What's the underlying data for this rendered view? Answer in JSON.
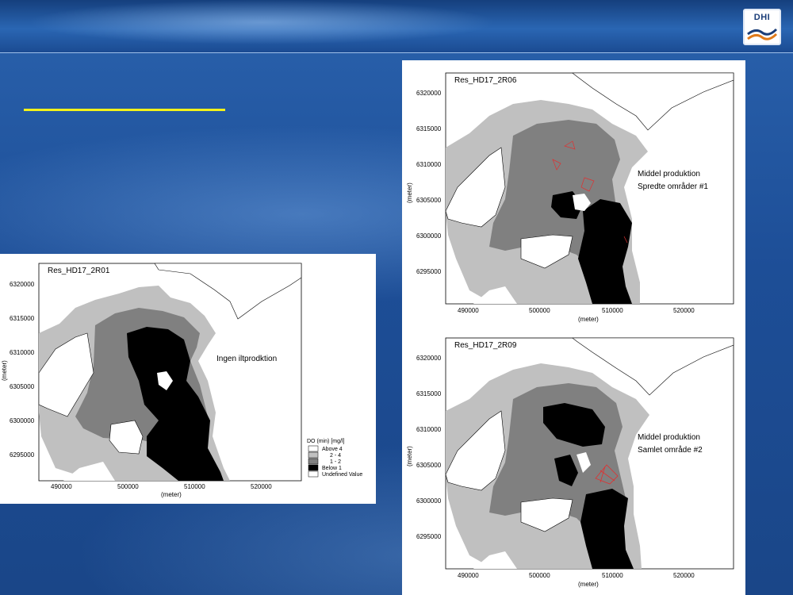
{
  "slide": {
    "logo_text": "DHI",
    "accent_color": "#f3f21b",
    "background_color": "#1f4f94"
  },
  "maps": [
    {
      "id": "r01",
      "title": "Res_HD17_2R01",
      "annotation_lines": [
        "Ingen iltprodktion"
      ],
      "y_ticks": [
        "6320000",
        "6315000",
        "6310000",
        "6305000",
        "6300000",
        "6295000"
      ],
      "x_ticks": [
        "490000",
        "500000",
        "510000",
        "520000"
      ],
      "x_label": "(meter)",
      "y_label": "(meter)",
      "has_legend": true
    },
    {
      "id": "r06",
      "title": "Res_HD17_2R06",
      "annotation_lines": [
        "Middel produktion",
        "Spredte områder #1"
      ],
      "y_ticks": [
        "6320000",
        "6315000",
        "6310000",
        "6305000",
        "6300000",
        "6295000"
      ],
      "x_ticks": [
        "490000",
        "500000",
        "510000",
        "520000"
      ],
      "x_label": "(meter)",
      "y_label": "(meter)",
      "has_legend": false
    },
    {
      "id": "r09",
      "title": "Res_HD17_2R09",
      "annotation_lines": [
        "Middel produktion",
        "Samlet område #2"
      ],
      "y_ticks": [
        "6320000",
        "6315000",
        "6310000",
        "6305000",
        "6300000",
        "6295000"
      ],
      "x_ticks": [
        "490000",
        "500000",
        "510000",
        "520000"
      ],
      "x_label": "(meter)",
      "y_label": "(meter)",
      "has_legend": false
    }
  ],
  "legend": {
    "title": "DO (min) [mg/l]",
    "items": [
      {
        "label": "Above 4",
        "color": "#ffffff"
      },
      {
        "label": "2 - 4",
        "color": "#c0c0c0"
      },
      {
        "label": "1 - 2",
        "color": "#808080"
      },
      {
        "label": "Below 1",
        "color": "#000000"
      },
      {
        "label": "Undefined Value",
        "color": "#ffffff"
      }
    ]
  },
  "colors": {
    "above4": "#ffffff",
    "range2_4": "#c0c0c0",
    "range1_2": "#808080",
    "below1": "#000000",
    "red_markers": "#e03030"
  }
}
